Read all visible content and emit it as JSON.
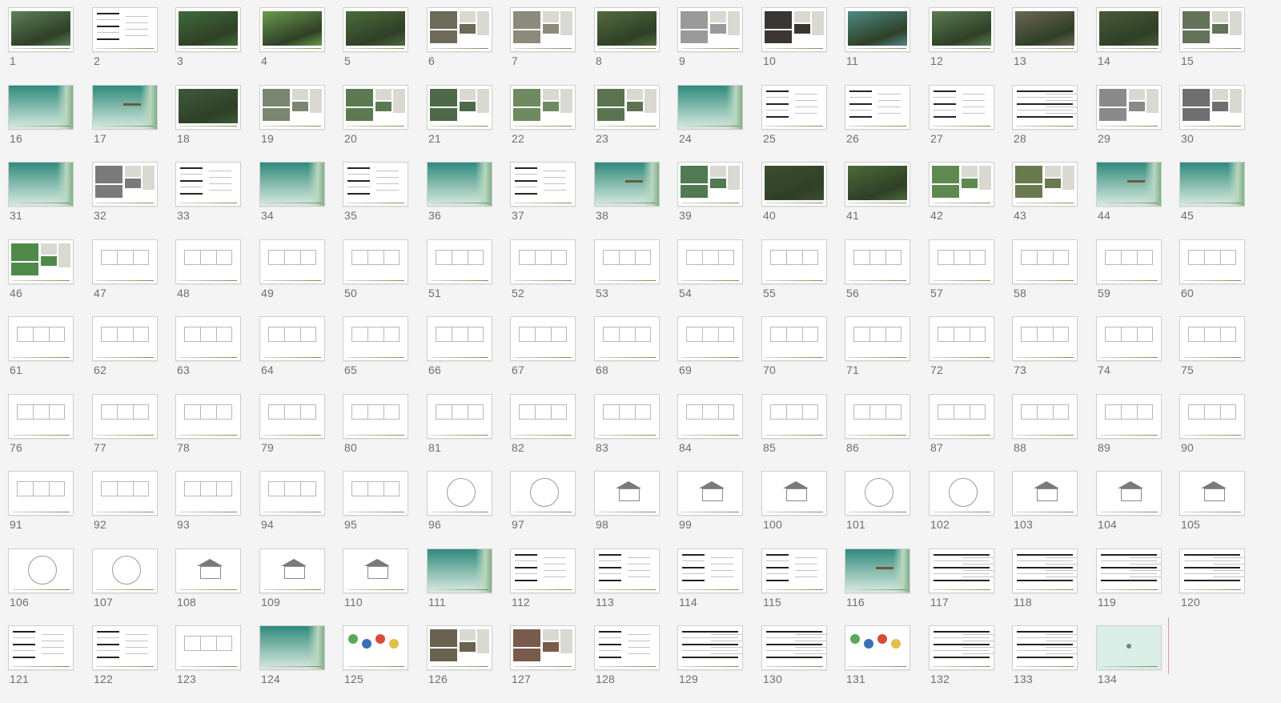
{
  "window": {
    "view": "Slide sorter"
  },
  "colors": {
    "background": "#f4f4f4",
    "thumb_border": "#cfcfcf",
    "teal": "#2f8a7e",
    "forest": "#4f6f3a",
    "label": "#6e6e6e",
    "insertion_marker": "#e09a9a"
  },
  "slides": [
    {
      "num": "1",
      "kind": "photo",
      "tone": "#5f7f58"
    },
    {
      "num": "2",
      "kind": "text"
    },
    {
      "num": "3",
      "kind": "photo",
      "tone": "#3f6c3a"
    },
    {
      "num": "4",
      "kind": "photo",
      "tone": "#6a9b4f"
    },
    {
      "num": "5",
      "kind": "photo",
      "tone": "#4e6b3b"
    },
    {
      "num": "6",
      "kind": "collage",
      "tone": "#6e6a5a"
    },
    {
      "num": "7",
      "kind": "collage",
      "tone": "#8c8a7a"
    },
    {
      "num": "8",
      "kind": "photo",
      "tone": "#546b3f"
    },
    {
      "num": "9",
      "kind": "collage",
      "tone": "#9a9a9a"
    },
    {
      "num": "10",
      "kind": "collage",
      "tone": "#3a3530"
    },
    {
      "num": "11",
      "kind": "photo",
      "tone": "#4d8c86"
    },
    {
      "num": "12",
      "kind": "photo",
      "tone": "#5c7c52"
    },
    {
      "num": "13",
      "kind": "photo",
      "tone": "#6d6658"
    },
    {
      "num": "14",
      "kind": "photo",
      "tone": "#4b5a36"
    },
    {
      "num": "15",
      "kind": "collage",
      "tone": "#65725a"
    },
    {
      "num": "16",
      "kind": "teal"
    },
    {
      "num": "17",
      "kind": "teal"
    },
    {
      "num": "18",
      "kind": "photo",
      "tone": "#3e5a3a"
    },
    {
      "num": "19",
      "kind": "collage",
      "tone": "#7a8670"
    },
    {
      "num": "20",
      "kind": "collage",
      "tone": "#5c7a52"
    },
    {
      "num": "21",
      "kind": "collage",
      "tone": "#4c6a48"
    },
    {
      "num": "22",
      "kind": "collage",
      "tone": "#6e8a60"
    },
    {
      "num": "23",
      "kind": "collage",
      "tone": "#5a7450"
    },
    {
      "num": "24",
      "kind": "teal"
    },
    {
      "num": "25",
      "kind": "text"
    },
    {
      "num": "26",
      "kind": "text"
    },
    {
      "num": "27",
      "kind": "text"
    },
    {
      "num": "28",
      "kind": "table"
    },
    {
      "num": "29",
      "kind": "collage",
      "tone": "#8a8a8a"
    },
    {
      "num": "30",
      "kind": "collage",
      "tone": "#6f6f6f"
    },
    {
      "num": "31",
      "kind": "teal"
    },
    {
      "num": "32",
      "kind": "collage",
      "tone": "#7a7a7a"
    },
    {
      "num": "33",
      "kind": "text"
    },
    {
      "num": "34",
      "kind": "teal"
    },
    {
      "num": "35",
      "kind": "text"
    },
    {
      "num": "36",
      "kind": "teal"
    },
    {
      "num": "37",
      "kind": "text"
    },
    {
      "num": "38",
      "kind": "teal"
    },
    {
      "num": "39",
      "kind": "collage",
      "tone": "#4f7a52"
    },
    {
      "num": "40",
      "kind": "photo",
      "tone": "#3d4f30"
    },
    {
      "num": "41",
      "kind": "photo",
      "tone": "#4d6a3a"
    },
    {
      "num": "42",
      "kind": "collage",
      "tone": "#5f8a4f"
    },
    {
      "num": "43",
      "kind": "collage",
      "tone": "#6a7a4f"
    },
    {
      "num": "44",
      "kind": "teal"
    },
    {
      "num": "45",
      "kind": "teal"
    },
    {
      "num": "46",
      "kind": "collage",
      "tone": "#4f8a4a"
    },
    {
      "num": "47",
      "kind": "drawing"
    },
    {
      "num": "48",
      "kind": "drawing"
    },
    {
      "num": "49",
      "kind": "drawing"
    },
    {
      "num": "50",
      "kind": "drawing"
    },
    {
      "num": "51",
      "kind": "drawing"
    },
    {
      "num": "52",
      "kind": "drawing"
    },
    {
      "num": "53",
      "kind": "drawing"
    },
    {
      "num": "54",
      "kind": "drawing"
    },
    {
      "num": "55",
      "kind": "drawing"
    },
    {
      "num": "56",
      "kind": "drawing"
    },
    {
      "num": "57",
      "kind": "drawing"
    },
    {
      "num": "58",
      "kind": "drawing"
    },
    {
      "num": "59",
      "kind": "drawing"
    },
    {
      "num": "60",
      "kind": "drawing"
    },
    {
      "num": "61",
      "kind": "drawing"
    },
    {
      "num": "62",
      "kind": "drawing"
    },
    {
      "num": "63",
      "kind": "drawing"
    },
    {
      "num": "64",
      "kind": "drawing"
    },
    {
      "num": "65",
      "kind": "drawing"
    },
    {
      "num": "66",
      "kind": "drawing"
    },
    {
      "num": "67",
      "kind": "drawing"
    },
    {
      "num": "68",
      "kind": "drawing"
    },
    {
      "num": "69",
      "kind": "drawing"
    },
    {
      "num": "70",
      "kind": "drawing"
    },
    {
      "num": "71",
      "kind": "drawing"
    },
    {
      "num": "72",
      "kind": "drawing"
    },
    {
      "num": "73",
      "kind": "drawing"
    },
    {
      "num": "74",
      "kind": "drawing"
    },
    {
      "num": "75",
      "kind": "drawing"
    },
    {
      "num": "76",
      "kind": "drawing"
    },
    {
      "num": "77",
      "kind": "drawing"
    },
    {
      "num": "78",
      "kind": "drawing"
    },
    {
      "num": "79",
      "kind": "drawing"
    },
    {
      "num": "80",
      "kind": "drawing"
    },
    {
      "num": "81",
      "kind": "drawing"
    },
    {
      "num": "82",
      "kind": "drawing"
    },
    {
      "num": "83",
      "kind": "drawing"
    },
    {
      "num": "84",
      "kind": "drawing"
    },
    {
      "num": "85",
      "kind": "drawing"
    },
    {
      "num": "86",
      "kind": "drawing"
    },
    {
      "num": "87",
      "kind": "drawing"
    },
    {
      "num": "88",
      "kind": "drawing"
    },
    {
      "num": "89",
      "kind": "drawing"
    },
    {
      "num": "90",
      "kind": "drawing"
    },
    {
      "num": "91",
      "kind": "drawing"
    },
    {
      "num": "92",
      "kind": "drawing"
    },
    {
      "num": "93",
      "kind": "drawing"
    },
    {
      "num": "94",
      "kind": "drawing"
    },
    {
      "num": "95",
      "kind": "drawing"
    },
    {
      "num": "96",
      "kind": "circle"
    },
    {
      "num": "97",
      "kind": "circle"
    },
    {
      "num": "98",
      "kind": "house"
    },
    {
      "num": "99",
      "kind": "house"
    },
    {
      "num": "100",
      "kind": "house"
    },
    {
      "num": "101",
      "kind": "circle"
    },
    {
      "num": "102",
      "kind": "circle"
    },
    {
      "num": "103",
      "kind": "house"
    },
    {
      "num": "104",
      "kind": "house"
    },
    {
      "num": "105",
      "kind": "house"
    },
    {
      "num": "106",
      "kind": "circle"
    },
    {
      "num": "107",
      "kind": "circle"
    },
    {
      "num": "108",
      "kind": "house"
    },
    {
      "num": "109",
      "kind": "house"
    },
    {
      "num": "110",
      "kind": "house"
    },
    {
      "num": "111",
      "kind": "teal"
    },
    {
      "num": "112",
      "kind": "text"
    },
    {
      "num": "113",
      "kind": "text"
    },
    {
      "num": "114",
      "kind": "text"
    },
    {
      "num": "115",
      "kind": "text"
    },
    {
      "num": "116",
      "kind": "teal"
    },
    {
      "num": "117",
      "kind": "table"
    },
    {
      "num": "118",
      "kind": "table"
    },
    {
      "num": "119",
      "kind": "table"
    },
    {
      "num": "120",
      "kind": "table"
    },
    {
      "num": "121",
      "kind": "text"
    },
    {
      "num": "122",
      "kind": "text"
    },
    {
      "num": "123",
      "kind": "drawing"
    },
    {
      "num": "124",
      "kind": "teal"
    },
    {
      "num": "125",
      "kind": "chart"
    },
    {
      "num": "126",
      "kind": "collage",
      "tone": "#6a6250"
    },
    {
      "num": "127",
      "kind": "collage",
      "tone": "#7a5a4a"
    },
    {
      "num": "128",
      "kind": "text"
    },
    {
      "num": "129",
      "kind": "table"
    },
    {
      "num": "130",
      "kind": "table"
    },
    {
      "num": "131",
      "kind": "chart"
    },
    {
      "num": "132",
      "kind": "table"
    },
    {
      "num": "133",
      "kind": "table"
    },
    {
      "num": "134",
      "kind": "mint"
    }
  ]
}
